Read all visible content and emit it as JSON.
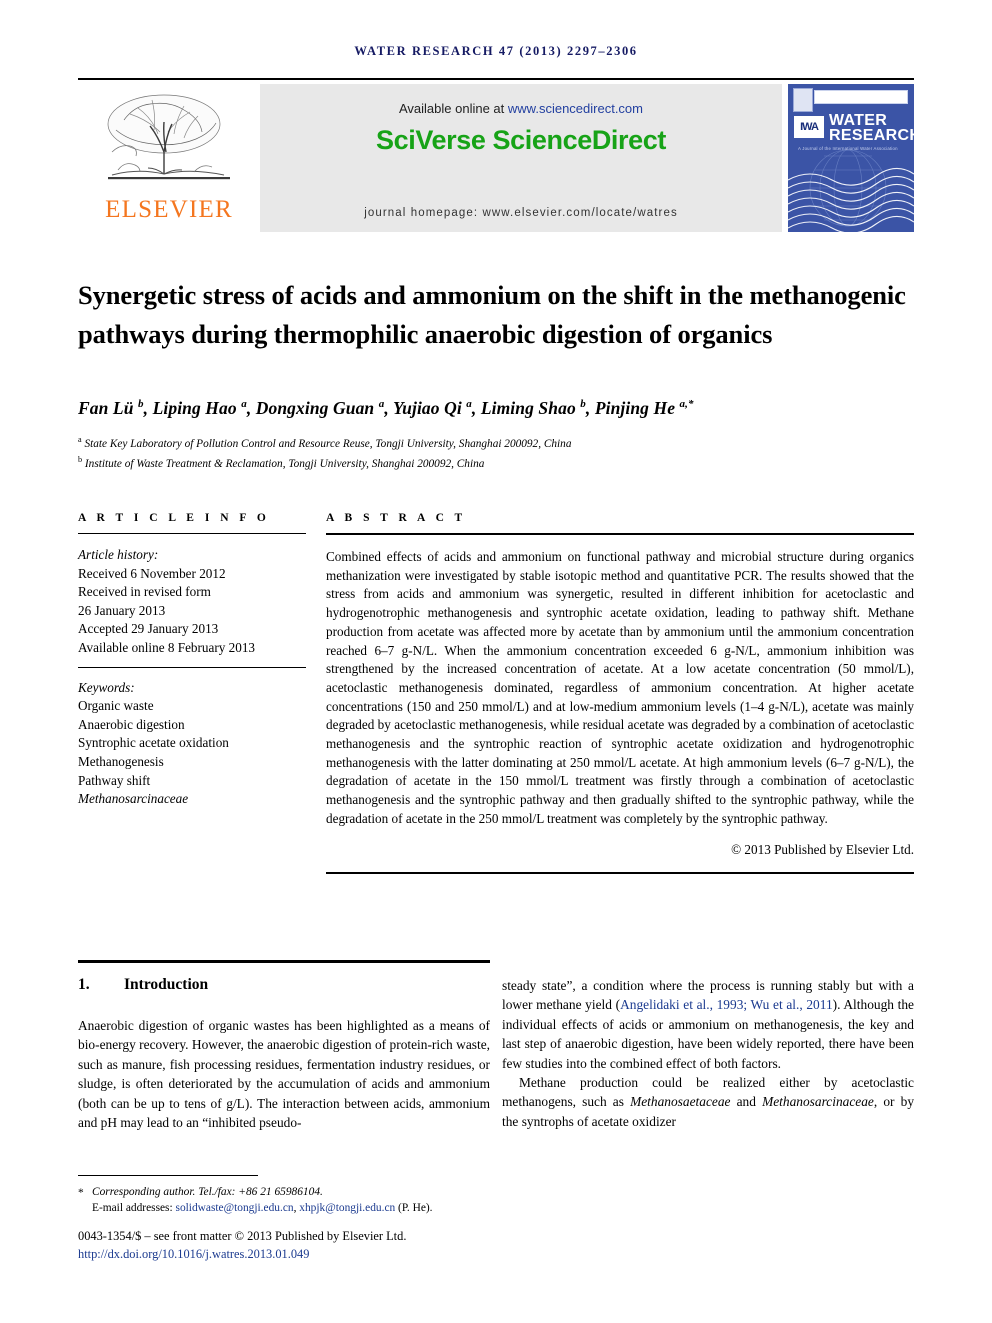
{
  "running_head": "Water Research 47 (2013) 2297–2306",
  "masthead": {
    "publisher_logo_label": "ELSEVIER",
    "available_prefix": "Available online at ",
    "available_link": "www.sciencedirect.com",
    "platform_title": "SciVerse ScienceDirect",
    "journal_homepage": "journal homepage: www.elsevier.com/locate/watres",
    "cover": {
      "society_logo": "IWA",
      "title_line1": "WATER",
      "title_line2": "RESEARCH",
      "subtitle": "A Journal of the International Water Association"
    }
  },
  "article": {
    "title": "Synergetic stress of acids and ammonium on the shift in the methanogenic pathways during thermophilic anaerobic digestion of organics",
    "authors_html": "Fan Lü <sup>b</sup>, Liping Hao <sup>a</sup>, Dongxing Guan <sup>a</sup>, Yujiao Qi <sup>a</sup>, Liming Shao <sup>b</sup>, Pinjing He <sup>a,*</sup>",
    "affiliations": [
      "State Key Laboratory of Pollution Control and Resource Reuse, Tongji University, Shanghai 200092, China",
      "Institute of Waste Treatment & Reclamation, Tongji University, Shanghai 200092, China"
    ],
    "affiliation_marks": [
      "a",
      "b"
    ]
  },
  "article_info": {
    "heading": "A R T I C L E   I N F O",
    "history_label": "Article history:",
    "history": [
      "Received 6 November 2012",
      "Received in revised form",
      "26 January 2013",
      "Accepted 29 January 2013",
      "Available online 8 February 2013"
    ],
    "keywords_label": "Keywords:",
    "keywords": [
      "Organic waste",
      "Anaerobic digestion",
      "Syntrophic acetate oxidation",
      "Methanogenesis",
      "Pathway shift",
      "Methanosarcinaceae"
    ],
    "keyword_italic_index": 5
  },
  "abstract": {
    "heading": "A B S T R A C T",
    "text": "Combined effects of acids and ammonium on functional pathway and microbial structure during organics methanization were investigated by stable isotopic method and quantitative PCR. The results showed that the stress from acids and ammonium was synergetic, resulted in different inhibition for acetoclastic and hydrogenotrophic methanogenesis and syntrophic acetate oxidation, leading to pathway shift. Methane production from acetate was affected more by acetate than by ammonium until the ammonium concentration reached 6–7 g-N/L. When the ammonium concentration exceeded 6 g-N/L, ammonium inhibition was strengthened by the increased concentration of acetate. At a low acetate concentration (50 mmol/L), acetoclastic methanogenesis dominated, regardless of ammonium concentration. At higher acetate concentrations (150 and 250 mmol/L) and at low-medium ammonium levels (1–4 g-N/L), acetate was mainly degraded by acetoclastic methanogenesis, while residual acetate was degraded by a combination of acetoclastic methanogenesis and the syntrophic reaction of syntrophic acetate oxidization and hydrogenotrophic methanogenesis with the latter dominating at 250 mmol/L acetate. At high ammonium levels (6–7 g-N/L), the degradation of acetate in the 150 mmol/L treatment was firstly through a combination of acetoclastic methanogenesis and the syntrophic pathway and then gradually shifted to the syntrophic pathway, while the degradation of acetate in the 250 mmol/L treatment was completely by the syntrophic pathway.",
    "copyright": "© 2013 Published by Elsevier Ltd."
  },
  "body": {
    "section_number": "1.",
    "section_title": "Introduction",
    "left_paragraph_1": "Anaerobic digestion of organic wastes has been highlighted as a means of bio-energy recovery. However, the anaerobic digestion of protein-rich waste, such as manure, fish processing residues, fermentation industry residues, or sludge, is often deteriorated by the accumulation of acids and ammonium (both can be up to tens of g/L). The interaction between acids, ammonium and pH may lead to an “inhibited pseudo-",
    "right_paragraph_1_part1": "steady state”, a condition where the process is running stably but with a lower methane yield (",
    "right_citation_1": "Angelidaki et al., 1993; Wu et al., 2011",
    "right_paragraph_1_part2": "). Although the individual effects of acids or ammonium on methanogenesis, the key and last step of anaerobic digestion, have been widely reported, there have been few studies into the combined effect of both factors.",
    "right_paragraph_2_part1": "Methane production could be realized either by acetoclastic methanogens, such as ",
    "right_italic_1": "Methanosaetaceae",
    "right_paragraph_2_part2": " and ",
    "right_italic_2": "Methanosarcinaceae",
    "right_paragraph_2_part3": ", or by the syntrophs of acetate oxidizer"
  },
  "footer": {
    "star": "*",
    "corresponding": "Corresponding author. Tel./fax: +86 21 65986104.",
    "email_label": "E-mail addresses: ",
    "email_1": "solidwaste@tongji.edu.cn",
    "email_sep": ", ",
    "email_2": "xhpjk@tongji.edu.cn",
    "email_suffix": " (P. He).",
    "imprint": "0043-1354/$ – see front matter © 2013 Published by Elsevier Ltd.",
    "doi": "http://dx.doi.org/10.1016/j.watres.2013.01.049"
  },
  "colors": {
    "navy": "#151a63",
    "elsevier_orange": "#f4761f",
    "sciencedirect_green": "#17a317",
    "link_blue": "#1b3a8f",
    "cover_blue": "#3b54a6",
    "banner_gray": "#e8e8e8"
  }
}
